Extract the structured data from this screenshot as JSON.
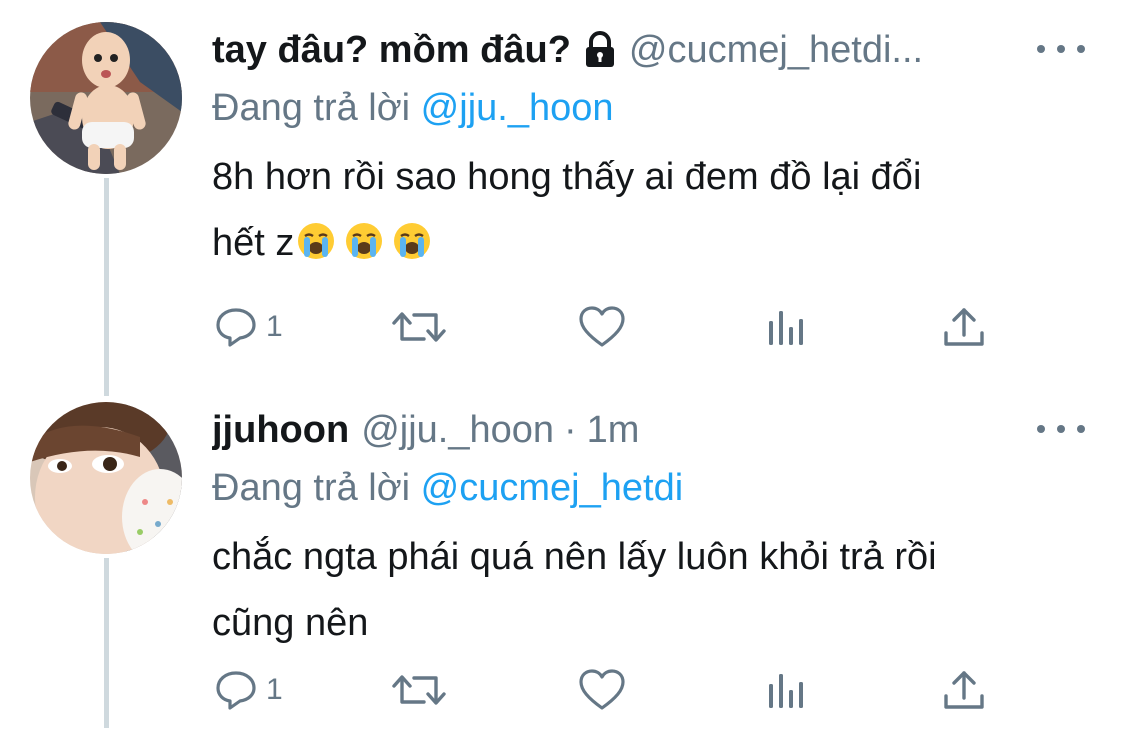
{
  "tweets": [
    {
      "display_name": "tay đâu? mồm đâu?",
      "handle": "@cucmej_hetdi...",
      "protected": true,
      "time": "",
      "replying_prefix": "Đang trả lời ",
      "replying_to": "@jju._hoon",
      "text_line1": "8h hơn rồi sao hong thấy ai đem đồ lại đổi",
      "text_line2": "hết z",
      "emojis": [
        "loudly-crying-face",
        "loudly-crying-face",
        "loudly-crying-face"
      ],
      "reply_count": "1"
    },
    {
      "display_name": "jjuhoon",
      "handle": "@jju._hoon",
      "separator": "·",
      "time": "1m",
      "replying_prefix": "Đang trả lời ",
      "replying_to": "@cucmej_hetdi",
      "text_line1": "chắc ngta phái quá nên lấy luôn khỏi trả rồi",
      "text_line2": "cũng nên",
      "reply_count": "1"
    }
  ],
  "colors": {
    "text": "#14171a",
    "secondary": "#657786",
    "mention": "#1da1f2",
    "thread_line": "#cfd9de",
    "background": "#ffffff"
  }
}
